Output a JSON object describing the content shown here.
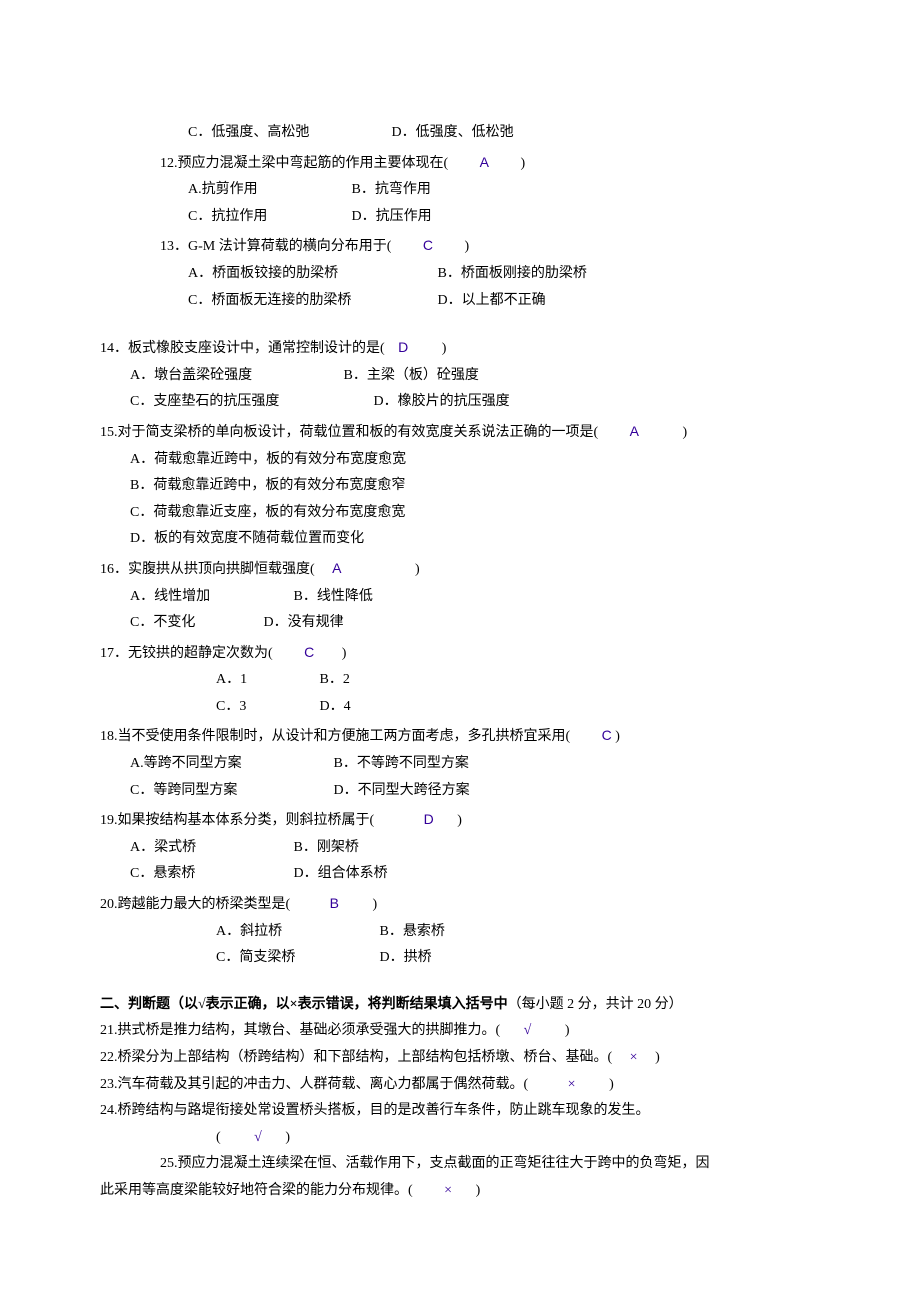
{
  "q11": {
    "optC": "C．低强度、高松弛",
    "optD": "D．低强度、低松弛"
  },
  "q12": {
    "stem_pre": "12.预应力混凝土梁中弯起筋的作用主要体现在(",
    "ans": "A",
    "stem_post": ")",
    "optA": "A.抗剪作用",
    "optB": "B．抗弯作用",
    "optC": "C．抗拉作用",
    "optD": "D．抗压作用"
  },
  "q13": {
    "stem_pre": "13．G-M 法计算荷载的横向分布用于(",
    "ans": "C",
    "stem_post": ")",
    "optA": "A．桥面板铰接的肋梁桥",
    "optB": "B．桥面板刚接的肋梁桥",
    "optC": "C．桥面板无连接的肋梁桥",
    "optD": "D．以上都不正确"
  },
  "q14": {
    "stem_pre": "14．板式橡胶支座设计中，通常控制设计的是(",
    "ans": "D",
    "stem_post": ")",
    "optA": "A．墩台盖梁砼强度",
    "optB": "B．主梁（板）砼强度",
    "optC": "C．支座垫石的抗压强度",
    "optD": "D．橡胶片的抗压强度"
  },
  "q15": {
    "stem_pre": "15.对于简支梁桥的单向板设计，荷载位置和板的有效宽度关系说法正确的一项是(",
    "ans": "A",
    "stem_post": ")",
    "optA": "A．荷载愈靠近跨中，板的有效分布宽度愈宽",
    "optB": "B．荷载愈靠近跨中，板的有效分布宽度愈窄",
    "optC": "C．荷载愈靠近支座，板的有效分布宽度愈宽",
    "optD": "D．板的有效宽度不随荷载位置而变化"
  },
  "q16": {
    "stem_pre": "16．实腹拱从拱顶向拱脚恒载强度(",
    "ans": "A",
    "stem_post": ")",
    "optA": "A．线性增加",
    "optB": "B．线性降低",
    "optC": "C．不变化",
    "optD": "D．没有规律"
  },
  "q17": {
    "stem_pre": "17．无铰拱的超静定次数为(",
    "ans": "C",
    "stem_post": ")",
    "optA": "A．1",
    "optB": "B．2",
    "optC": "C．3",
    "optD": "D．4"
  },
  "q18": {
    "stem_pre": "18.当不受使用条件限制时，从设计和方便施工两方面考虑，多孔拱桥宜采用(",
    "ans": "C",
    "stem_post": ")",
    "optA": "A.等跨不同型方案",
    "optB": "B．不等跨不同型方案",
    "optC": "C．等跨同型方案",
    "optD": "D．不同型大跨径方案"
  },
  "q19": {
    "stem_pre": "19.如果按结构基本体系分类，则斜拉桥属于(",
    "ans": "D",
    "stem_post": ")",
    "optA": "A．梁式桥",
    "optB": "B．刚架桥",
    "optC": "C．悬索桥",
    "optD": "D．组合体系桥"
  },
  "q20": {
    "stem_pre": "20.跨越能力最大的桥梁类型是(",
    "ans": "B",
    "stem_post": ")",
    "optA": "A．斜拉桥",
    "optB": "B．悬索桥",
    "optC": "C．简支梁桥",
    "optD": "D．拱桥"
  },
  "section2": {
    "title_bold": "二、判断题（以√表示正确，以×表示错误，将判断结果填入括号中",
    "title_rest": "（每小题 2 分，共计 20 分）"
  },
  "q21": {
    "pre": "21.拱式桥是推力结构，其墩台、基础必须承受强大的拱脚推力。(",
    "ans": "√",
    "post": ")"
  },
  "q22": {
    "pre": "22.桥梁分为上部结构（桥跨结构）和下部结构，上部结构包括桥墩、桥台、基础。(",
    "ans": "×",
    "post": ")"
  },
  "q23": {
    "pre": "23.汽车荷载及其引起的冲击力、人群荷载、离心力都属于偶然荷载。(",
    "ans": "×",
    "post": ")"
  },
  "q24": {
    "pre": "24.桥跨结构与路堤衔接处常设置桥头搭板，目的是改善行车条件，防止跳车现象的发生。",
    "paren_pre": "(",
    "ans": "√",
    "paren_post": ")"
  },
  "q25": {
    "line1": "25.预应力混凝土连续梁在恒、活载作用下，支点截面的正弯矩往往大于跨中的负弯矩，因",
    "line2_pre": "此采用等高度梁能较好地符合梁的能力分布规律。(",
    "ans": "×",
    "line2_post": ")"
  }
}
